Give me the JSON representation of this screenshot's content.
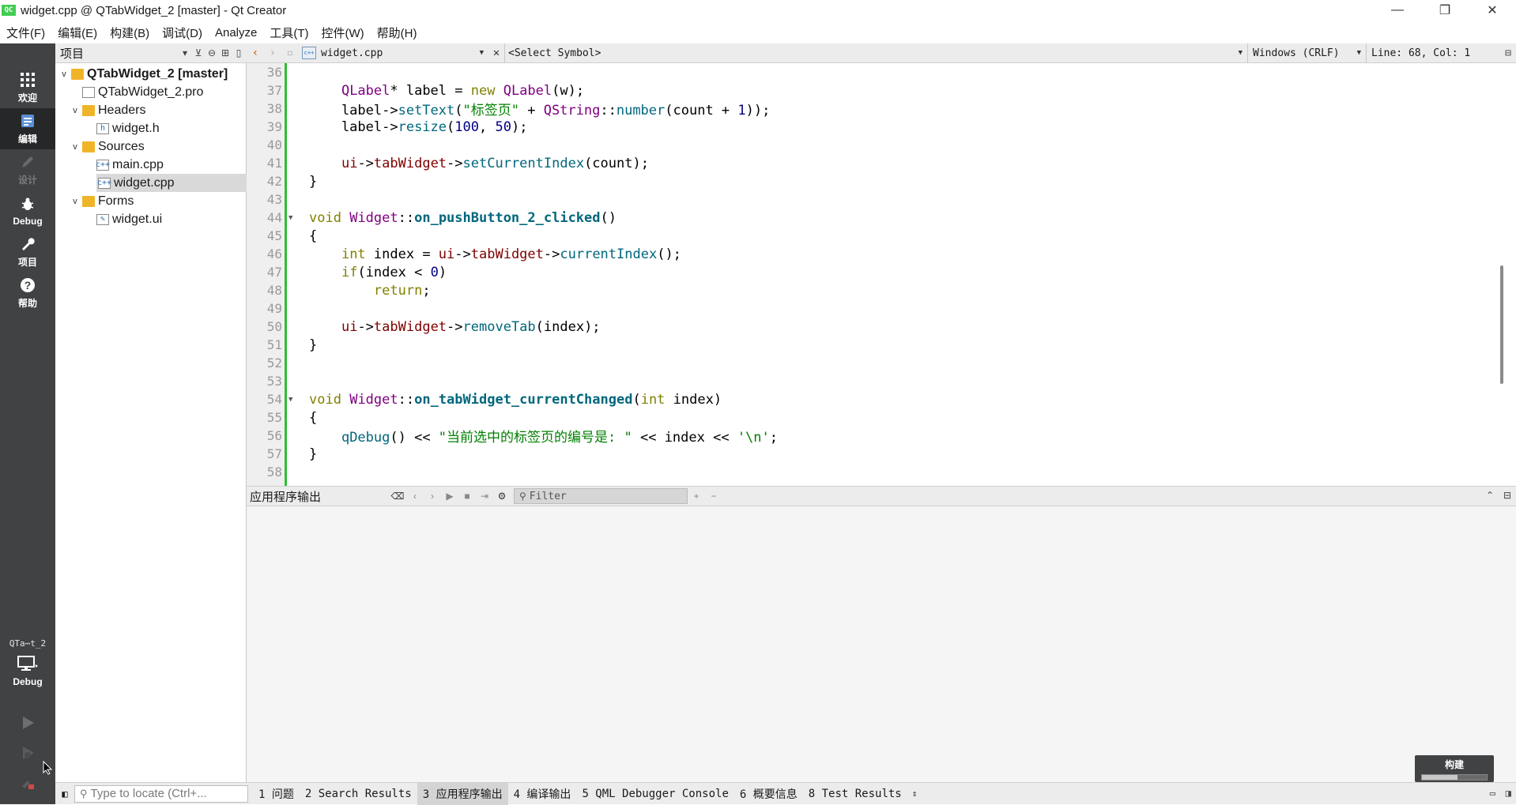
{
  "window": {
    "title": "widget.cpp @ QTabWidget_2 [master] - Qt Creator",
    "app_icon_text": "QC",
    "controls": [
      "minimize",
      "restore",
      "close"
    ]
  },
  "menubar": [
    "文件(F)",
    "编辑(E)",
    "构建(B)",
    "调试(D)",
    "Analyze",
    "工具(T)",
    "控件(W)",
    "帮助(H)"
  ],
  "modes": [
    {
      "label": "欢迎",
      "icon": "grid-icon"
    },
    {
      "label": "编辑",
      "icon": "edit-doc-icon",
      "active": true
    },
    {
      "label": "设计",
      "icon": "pencil-icon",
      "disabled": true
    },
    {
      "label": "Debug",
      "icon": "bug-icon"
    },
    {
      "label": "项目",
      "icon": "wrench-icon"
    },
    {
      "label": "帮助",
      "icon": "help-icon"
    }
  ],
  "kit": {
    "project": "QTa⋯t_2",
    "config": "Debug"
  },
  "project_pane": {
    "selector": "项目",
    "tree": [
      {
        "label": "QTabWidget_2 [master]",
        "level": 0,
        "type": "project",
        "expanded": true,
        "bold": true
      },
      {
        "label": "QTabWidget_2.pro",
        "level": 1,
        "type": "pro"
      },
      {
        "label": "Headers",
        "level": 1,
        "type": "folder",
        "expanded": true
      },
      {
        "label": "widget.h",
        "level": 2,
        "type": "header"
      },
      {
        "label": "Sources",
        "level": 1,
        "type": "folder",
        "expanded": true
      },
      {
        "label": "main.cpp",
        "level": 2,
        "type": "cpp"
      },
      {
        "label": "widget.cpp",
        "level": 2,
        "type": "cpp",
        "selected": true
      },
      {
        "label": "Forms",
        "level": 1,
        "type": "folder",
        "expanded": true
      },
      {
        "label": "widget.ui",
        "level": 2,
        "type": "ui"
      }
    ]
  },
  "editor_toolbar": {
    "file": "widget.cpp",
    "symbol": "<Select Symbol>",
    "line_ending": "Windows (CRLF)",
    "position": "Line: 68, Col: 1"
  },
  "code": [
    {
      "n": "36",
      "tokens": []
    },
    {
      "n": "37",
      "tokens": [
        [
          "pl",
          "    "
        ],
        [
          "ty",
          "QLabel"
        ],
        [
          "pl",
          "* label = "
        ],
        [
          "kw",
          "new"
        ],
        [
          "pl",
          " "
        ],
        [
          "ty",
          "QLabel"
        ],
        [
          "pl",
          "(w);"
        ]
      ]
    },
    {
      "n": "38",
      "tokens": [
        [
          "pl",
          "    label->"
        ],
        [
          "fn",
          "setText"
        ],
        [
          "pl",
          "("
        ],
        [
          "str",
          "\"标签页\""
        ],
        [
          "pl",
          " + "
        ],
        [
          "ty",
          "QString"
        ],
        [
          "pl",
          "::"
        ],
        [
          "fn",
          "number"
        ],
        [
          "pl",
          "(count + "
        ],
        [
          "num",
          "1"
        ],
        [
          "pl",
          "));"
        ]
      ]
    },
    {
      "n": "39",
      "tokens": [
        [
          "pl",
          "    label->"
        ],
        [
          "fn",
          "resize"
        ],
        [
          "pl",
          "("
        ],
        [
          "num",
          "100"
        ],
        [
          "pl",
          ", "
        ],
        [
          "num",
          "50"
        ],
        [
          "pl",
          ");"
        ]
      ]
    },
    {
      "n": "40",
      "tokens": []
    },
    {
      "n": "41",
      "tokens": [
        [
          "pl",
          "    "
        ],
        [
          "mem",
          "ui"
        ],
        [
          "pl",
          "->"
        ],
        [
          "mem",
          "tabWidget"
        ],
        [
          "pl",
          "->"
        ],
        [
          "fn",
          "setCurrentIndex"
        ],
        [
          "pl",
          "(count);"
        ]
      ]
    },
    {
      "n": "42",
      "tokens": [
        [
          "pl",
          "}"
        ]
      ]
    },
    {
      "n": "43",
      "tokens": []
    },
    {
      "n": "44",
      "fold": true,
      "tokens": [
        [
          "kw",
          "void"
        ],
        [
          "pl",
          " "
        ],
        [
          "ty",
          "Widget"
        ],
        [
          "pl",
          "::"
        ],
        [
          "fnb",
          "on_pushButton_2_clicked"
        ],
        [
          "pl",
          "()"
        ]
      ]
    },
    {
      "n": "45",
      "tokens": [
        [
          "pl",
          "{"
        ]
      ]
    },
    {
      "n": "46",
      "tokens": [
        [
          "pl",
          "    "
        ],
        [
          "kw",
          "int"
        ],
        [
          "pl",
          " index = "
        ],
        [
          "mem",
          "ui"
        ],
        [
          "pl",
          "->"
        ],
        [
          "mem",
          "tabWidget"
        ],
        [
          "pl",
          "->"
        ],
        [
          "fn",
          "currentIndex"
        ],
        [
          "pl",
          "();"
        ]
      ]
    },
    {
      "n": "47",
      "tokens": [
        [
          "pl",
          "    "
        ],
        [
          "kw",
          "if"
        ],
        [
          "pl",
          "(index < "
        ],
        [
          "num",
          "0"
        ],
        [
          "pl",
          ")"
        ]
      ]
    },
    {
      "n": "48",
      "tokens": [
        [
          "pl",
          "        "
        ],
        [
          "kw",
          "return"
        ],
        [
          "pl",
          ";"
        ]
      ]
    },
    {
      "n": "49",
      "tokens": []
    },
    {
      "n": "50",
      "tokens": [
        [
          "pl",
          "    "
        ],
        [
          "mem",
          "ui"
        ],
        [
          "pl",
          "->"
        ],
        [
          "mem",
          "tabWidget"
        ],
        [
          "pl",
          "->"
        ],
        [
          "fn",
          "removeTab"
        ],
        [
          "pl",
          "(index);"
        ]
      ]
    },
    {
      "n": "51",
      "tokens": [
        [
          "pl",
          "}"
        ]
      ]
    },
    {
      "n": "52",
      "tokens": []
    },
    {
      "n": "53",
      "tokens": []
    },
    {
      "n": "54",
      "fold": true,
      "tokens": [
        [
          "kw",
          "void"
        ],
        [
          "pl",
          " "
        ],
        [
          "ty",
          "Widget"
        ],
        [
          "pl",
          "::"
        ],
        [
          "fnb",
          "on_tabWidget_currentChanged"
        ],
        [
          "pl",
          "("
        ],
        [
          "kw",
          "int"
        ],
        [
          "pl",
          " index)"
        ]
      ]
    },
    {
      "n": "55",
      "tokens": [
        [
          "pl",
          "{"
        ]
      ]
    },
    {
      "n": "56",
      "tokens": [
        [
          "pl",
          "    "
        ],
        [
          "fn",
          "qDebug"
        ],
        [
          "pl",
          "() << "
        ],
        [
          "str",
          "\"当前选中的标签页的编号是: \""
        ],
        [
          "pl",
          " << index << "
        ],
        [
          "str",
          "'\\n'"
        ],
        [
          "pl",
          ";"
        ]
      ]
    },
    {
      "n": "57",
      "tokens": [
        [
          "pl",
          "}"
        ]
      ]
    },
    {
      "n": "58",
      "tokens": []
    }
  ],
  "output_pane": {
    "title": "应用程序输出",
    "filter_placeholder": "Filter"
  },
  "build_widget": {
    "label": "构建",
    "progress": 0.55
  },
  "statusbar": {
    "locator_placeholder": "Type to locate (Ctrl+...",
    "tabs": [
      "1 问题",
      "2 Search Results",
      "3 应用程序输出",
      "4 编译输出",
      "5 QML Debugger Console",
      "6 概要信息",
      "8 Test Results"
    ],
    "active_tab": 2
  },
  "colors": {
    "modebar": "#404244",
    "mode_active": "#262728",
    "keyword": "#808000",
    "type": "#800080",
    "function": "#00677c",
    "member": "#800000",
    "string": "#008000",
    "number": "#000080",
    "changed_bar": "#2fbf2f"
  }
}
